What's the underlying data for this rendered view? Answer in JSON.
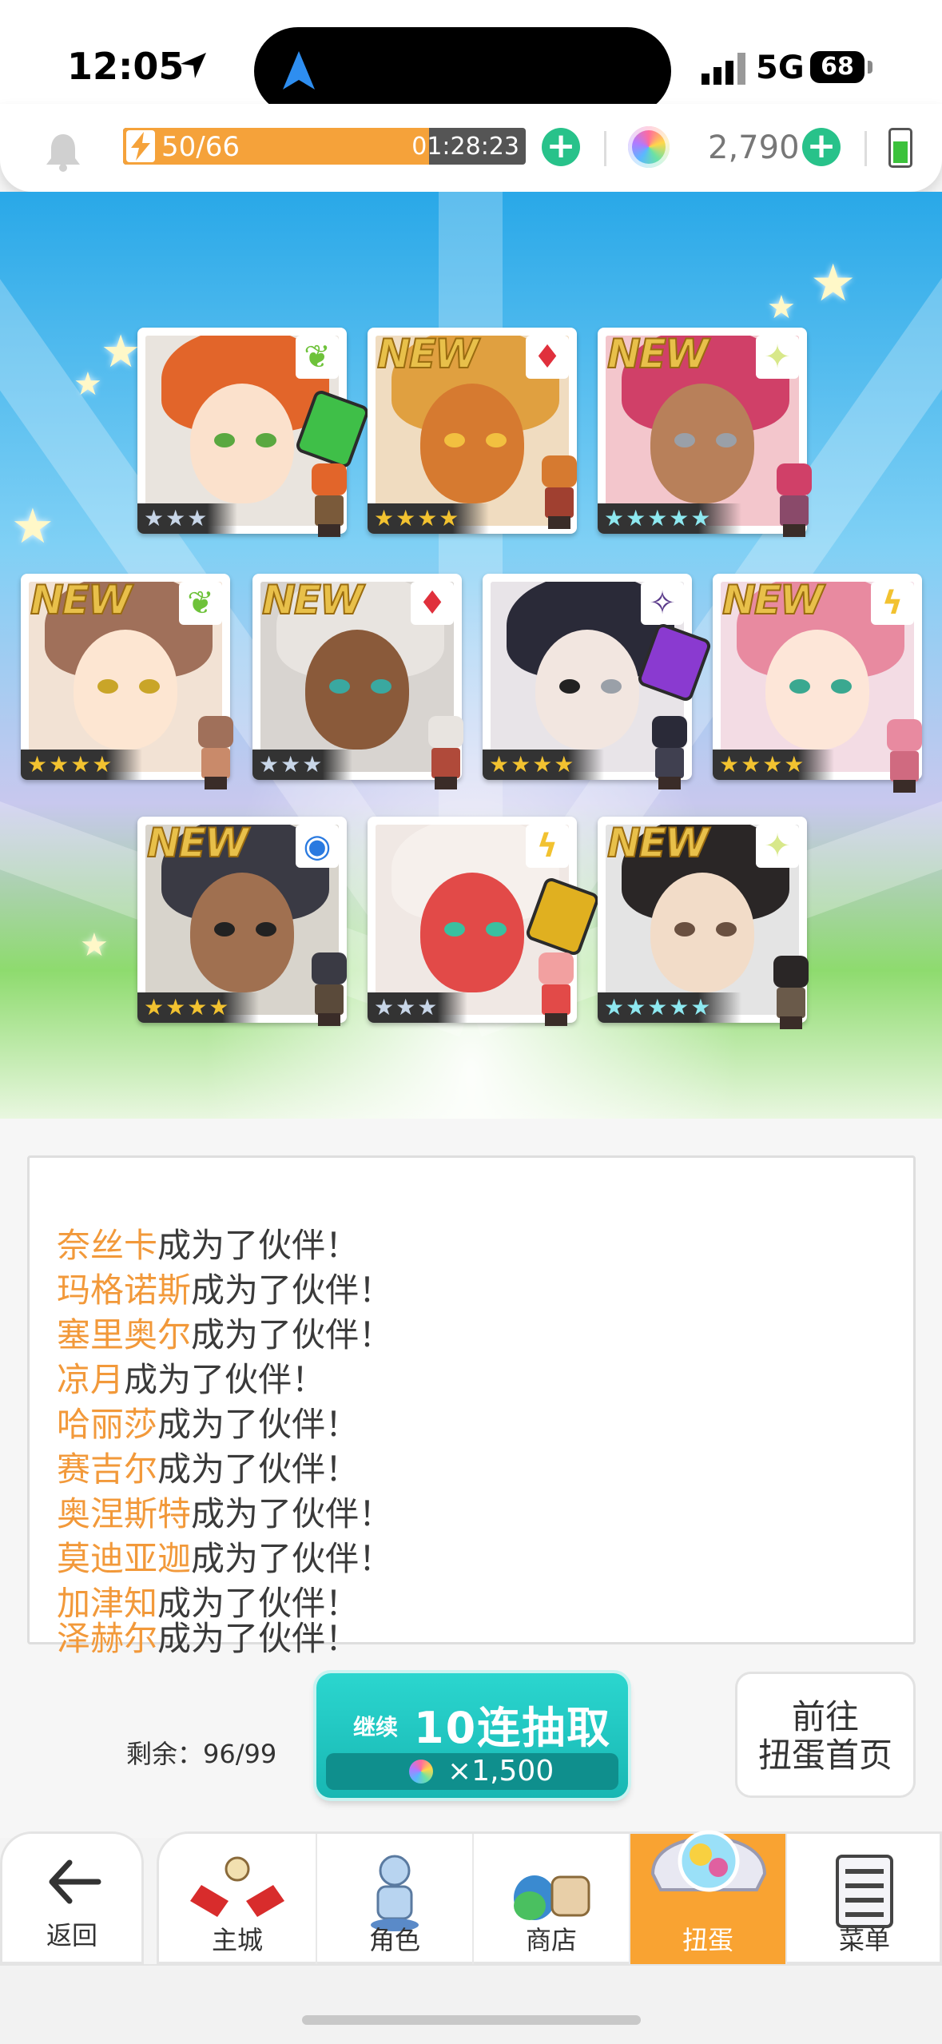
{
  "status_bar": {
    "time": "12:05",
    "network": "5G",
    "battery": "68"
  },
  "resource_bar": {
    "stamina_text": "50/66",
    "stamina_fraction": 0.76,
    "stamina_timer": "01:28:23",
    "gems": "2,790"
  },
  "cards": [
    {
      "new": "",
      "attribute": "nature",
      "stars": "★★★"
    },
    {
      "new": "NEW",
      "attribute": "fire",
      "stars": "★★★★"
    },
    {
      "new": "NEW",
      "attribute": "light",
      "stars": "★★★★★"
    },
    {
      "new": "NEW",
      "attribute": "nature",
      "stars": "★★★★"
    },
    {
      "new": "NEW",
      "attribute": "fire",
      "stars": "★★★"
    },
    {
      "new": "",
      "attribute": "dark",
      "stars": "★★★★"
    },
    {
      "new": "NEW",
      "attribute": "thunder",
      "stars": "★★★★"
    },
    {
      "new": "NEW",
      "attribute": "water",
      "stars": "★★★★"
    },
    {
      "new": "",
      "attribute": "thunder",
      "stars": "★★★"
    },
    {
      "new": "NEW",
      "attribute": "light",
      "stars": "★★★★★"
    }
  ],
  "log": {
    "suffix": "成为了伙伴！",
    "names": [
      "奈丝卡",
      "玛格诺斯",
      "塞里奥尔",
      "凉月",
      "哈丽莎",
      "赛吉尔",
      "奥涅斯特",
      "莫迪亚迦",
      "加津知",
      "泽赫尔"
    ]
  },
  "remaining": "剩余：96/99",
  "continue_button": {
    "small": "继续",
    "main": "10连抽取",
    "cost": "×1,500"
  },
  "goto_button": {
    "line1": "前往",
    "line2": "扭蛋首页"
  },
  "nav": {
    "back": "返回",
    "tabs": [
      "主城",
      "角色",
      "商店",
      "扭蛋",
      "菜单"
    ],
    "active": "扭蛋"
  },
  "colors": {
    "accent_orange": "#f9a332",
    "name_orange": "#f2993a",
    "teal": "#18b7b3",
    "stamina": "#f5a23a"
  }
}
